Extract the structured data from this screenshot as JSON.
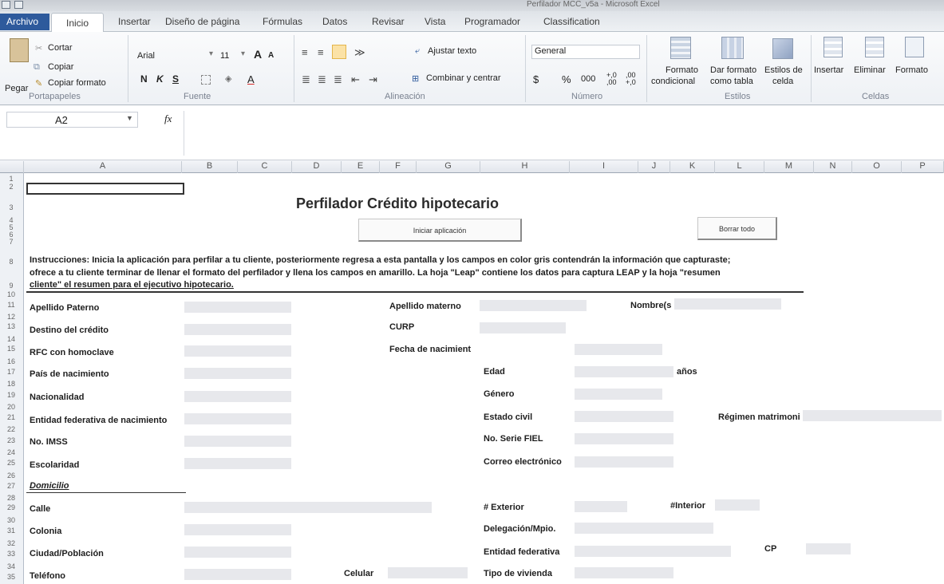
{
  "window": {
    "title": "Perfilador MCC_v5a - Microsoft Excel"
  },
  "tabs": [
    "Archivo",
    "Inicio",
    "Insertar",
    "Diseño de página",
    "Fórmulas",
    "Datos",
    "Revisar",
    "Vista",
    "Programador",
    "Classification"
  ],
  "ribbon": {
    "clipboard": {
      "paste": "Pegar",
      "cut": "Cortar",
      "copy": "Copiar",
      "copy_format": "Copiar formato",
      "group": "Portapapeles"
    },
    "font": {
      "name": "Arial",
      "size": "11",
      "bold": "N",
      "italic": "K",
      "underline": "S",
      "grow": "A",
      "shrink": "A",
      "color_a": "A",
      "group": "Fuente"
    },
    "alignment": {
      "wrap": "Ajustar texto",
      "merge": "Combinar y centrar",
      "group": "Alineación"
    },
    "number": {
      "format": "General",
      "currency": "$",
      "percent": "%",
      "thousands": "000",
      "inc_dec": "+,0\n,00",
      "dec_dec": ",00\n+,0",
      "group": "Número"
    },
    "styles": {
      "conditional": "Formato",
      "conditional_2": "condicional",
      "table": "Dar formato",
      "table_2": "como tabla",
      "cell": "Estilos de",
      "cell_2": "celda",
      "group": "Estilos"
    },
    "cells": {
      "insert": "Insertar",
      "delete": "Eliminar",
      "format": "Formato",
      "group": "Celdas"
    }
  },
  "formula_bar": {
    "cell_ref": "A2",
    "fx": "fx",
    "content": ""
  },
  "columns": [
    "A",
    "B",
    "C",
    "D",
    "E",
    "F",
    "G",
    "H",
    "I",
    "J",
    "K",
    "L",
    "M",
    "N",
    "O",
    "P"
  ],
  "rows": [
    "1",
    "2",
    "3",
    "4",
    "5",
    "6",
    "7",
    "8",
    "9",
    "10",
    "11",
    "12",
    "13",
    "14",
    "15",
    "16",
    "17",
    "18",
    "19",
    "20",
    "21",
    "22",
    "23",
    "24",
    "25",
    "26",
    "27",
    "28",
    "29",
    "30",
    "31",
    "32",
    "33",
    "34",
    "35"
  ],
  "sheet": {
    "title": "Perfilador Crédito hipotecario",
    "start_button": "Iniciar aplicación",
    "clear_button": "Borrar todo",
    "instructions_1": "Instrucciones: Inicia la aplicación para perfilar a tu cliente, posteriormente regresa a esta pantalla y los campos en color gris contendrán la información que capturaste;",
    "instructions_2": "ofrece a tu cliente terminar de llenar el formato del perfilador y llena los campos en amarillo. La hoja \"Leap\" contiene los datos para captura LEAP y la hoja \"resumen",
    "instructions_3": "cliente\" el resumen para el ejecutivo hipotecario.",
    "labels": {
      "apellido_paterno": "Apellido Paterno",
      "apellido_materno": "Apellido materno",
      "nombre": "Nombre(s",
      "destino": "Destino del crédito",
      "curp": "CURP",
      "rfc": "RFC con homoclave",
      "fecha_nac": "Fecha de nacimient",
      "pais": "País de nacimiento",
      "edad": "Edad",
      "anios": "años",
      "nacionalidad": "Nacionalidad",
      "genero": "Género",
      "entidad_nac": "Entidad federativa de nacimiento",
      "estado_civil": "Estado civil",
      "regimen": "Régimen matrimoni",
      "imss": "No. IMSS",
      "fiel": "No. Serie FIEL",
      "escolaridad": "Escolaridad",
      "correo": "Correo electrónico",
      "domicilio": "Domicilio",
      "calle": "Calle",
      "exterior": "# Exterior",
      "interior": "#Interior",
      "colonia": "Colonia",
      "delegacion": "Delegación/Mpio.",
      "ciudad": "Ciudad/Población",
      "entidad": "Entidad federativa",
      "cp": "CP",
      "telefono": "Teléfono",
      "celular": "Celular",
      "vivienda": "Tipo de vivienda"
    }
  }
}
